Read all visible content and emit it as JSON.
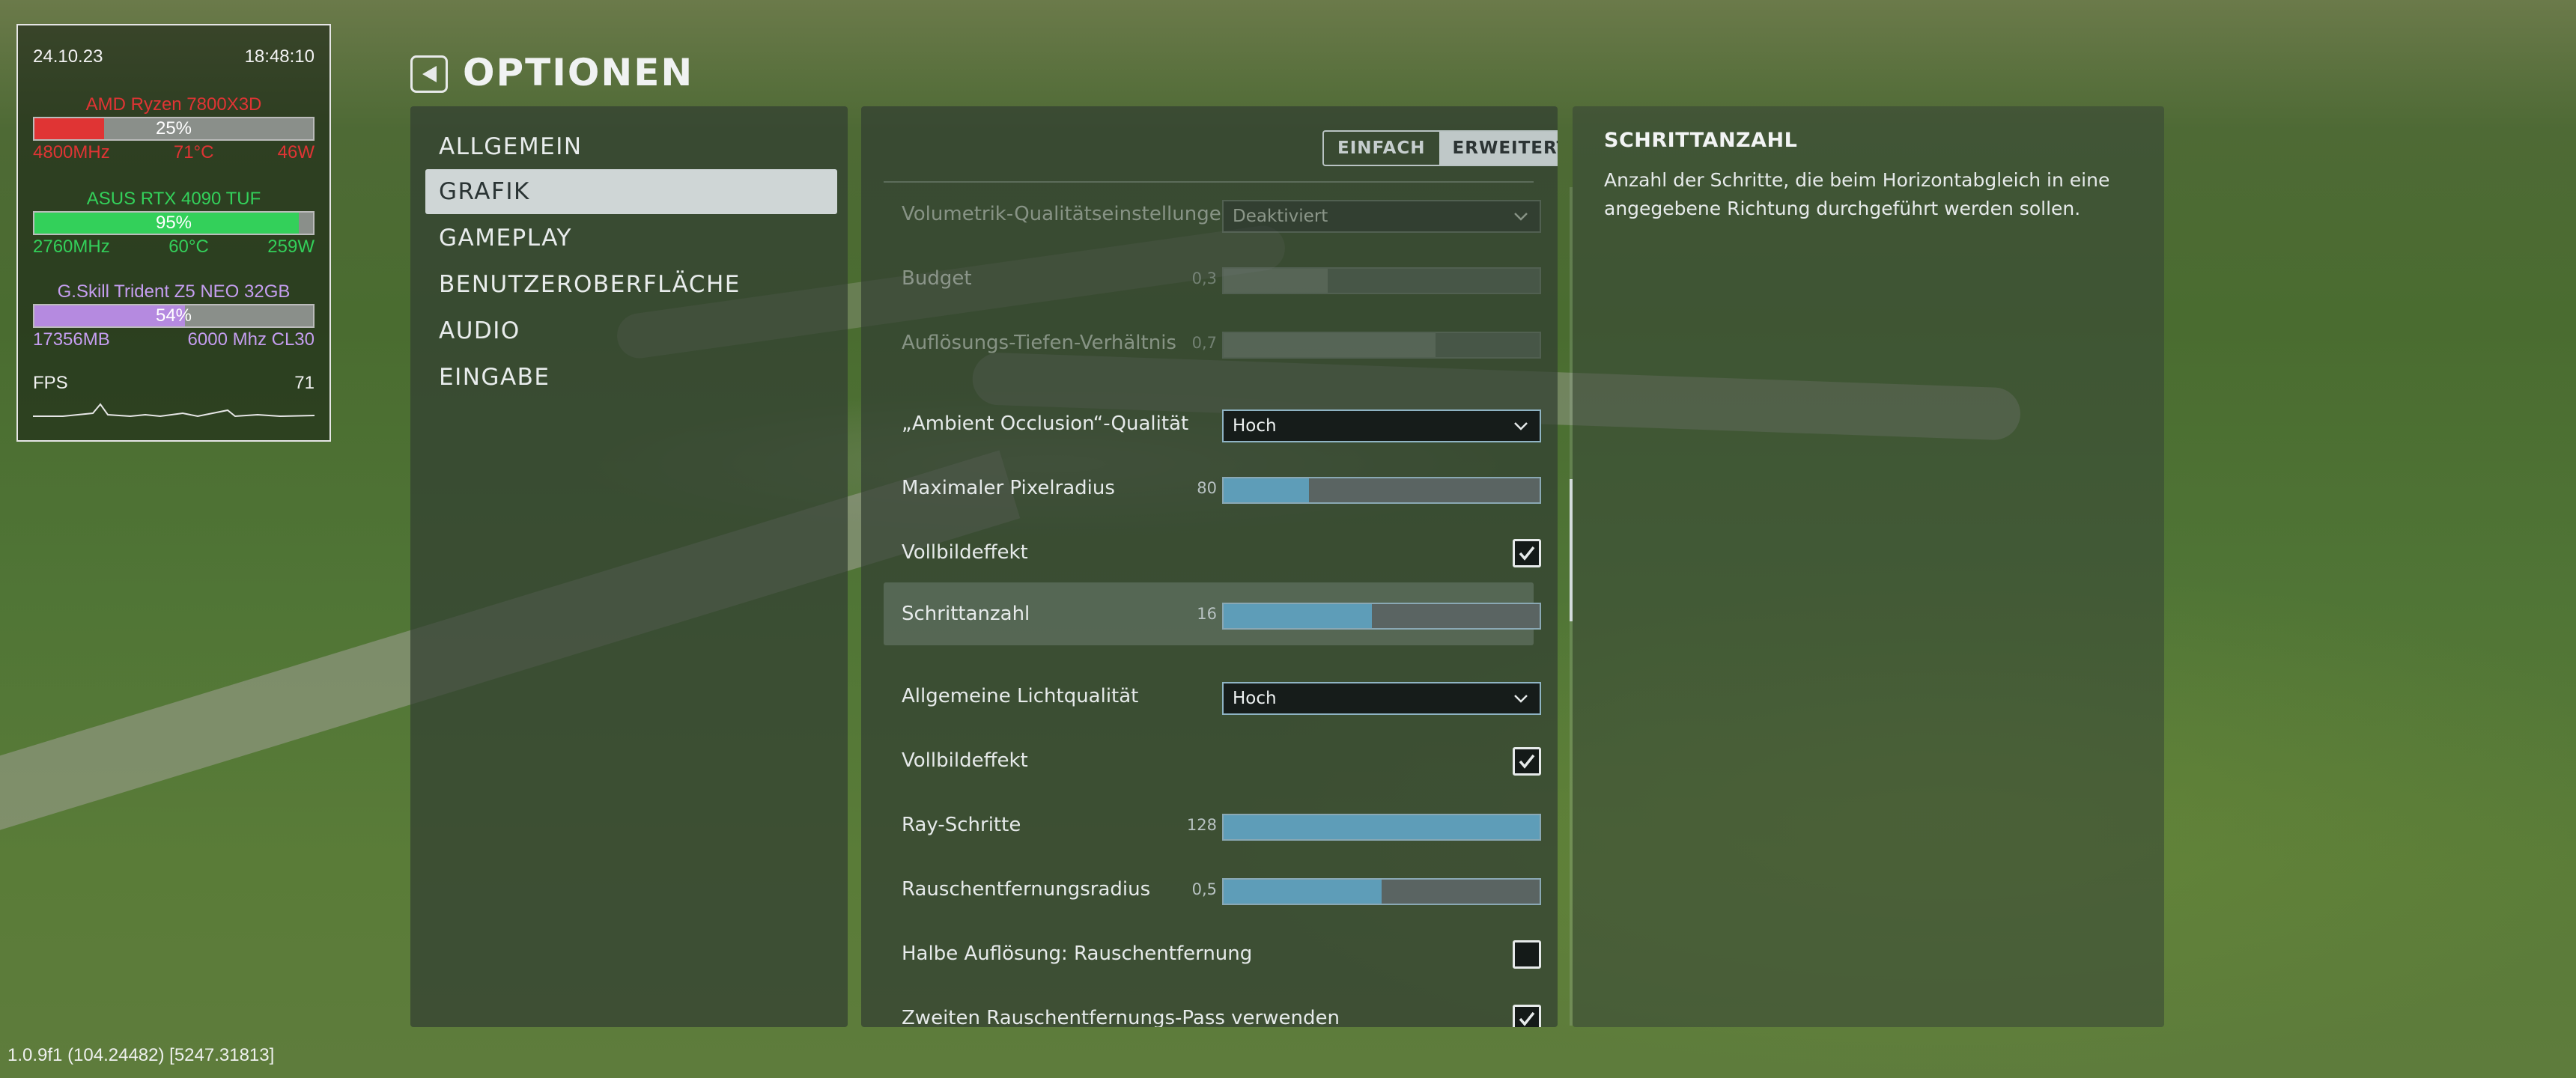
{
  "monitor": {
    "date": "24.10.23",
    "time": "18:48:10",
    "cpu": {
      "name": "AMD Ryzen 7800X3D",
      "load": "25%",
      "load_fraction": 0.25,
      "clock": "4800MHz",
      "temp": "71°C",
      "power": "46W",
      "color": "#e03434"
    },
    "gpu": {
      "name": "ASUS RTX 4090 TUF",
      "load": "95%",
      "load_fraction": 0.95,
      "clock": "2760MHz",
      "temp": "60°C",
      "power": "259W",
      "color": "#33d05a"
    },
    "ram": {
      "name": "G.Skill Trident Z5 NEO 32GB",
      "load": "54%",
      "load_fraction": 0.54,
      "used": "17356MB",
      "speed": "6000 Mhz CL30",
      "color": "#b58ae0"
    },
    "fps": {
      "label": "FPS",
      "value": "71"
    }
  },
  "header": {
    "title": "OPTIONEN",
    "back_icon": "back-arrow-icon"
  },
  "nav": {
    "items": [
      {
        "label": "ALLGEMEIN",
        "active": false
      },
      {
        "label": "GRAFIK",
        "active": true
      },
      {
        "label": "GAMEPLAY",
        "active": false
      },
      {
        "label": "BENUTZEROBERFLÄCHE",
        "active": false
      },
      {
        "label": "AUDIO",
        "active": false
      },
      {
        "label": "EINGABE",
        "active": false
      }
    ]
  },
  "mode": {
    "simple": "EINFACH",
    "advanced": "ERWEITERT",
    "selected": "ERWEITERT"
  },
  "settings": [
    {
      "label": "Volumetrik-Qualitätseinstellungen",
      "type": "dropdown",
      "value": "Deaktiviert",
      "disabled": true
    },
    {
      "label": "Budget",
      "type": "slider",
      "value": "0,3",
      "fill": 0.33,
      "disabled": true
    },
    {
      "label": "Auflösungs-Tiefen-Verhältnis",
      "type": "slider",
      "value": "0,7",
      "fill": 0.67,
      "disabled": true
    },
    {
      "label": "„Ambient Occlusion“-Qualität",
      "type": "dropdown",
      "value": "Hoch",
      "disabled": false
    },
    {
      "label": "Maximaler Pixelradius",
      "type": "slider",
      "value": "80",
      "fill": 0.27,
      "disabled": false
    },
    {
      "label": "Vollbildeffekt",
      "type": "checkbox",
      "checked": true
    },
    {
      "label": "Schrittanzahl",
      "type": "slider",
      "value": "16",
      "fill": 0.47,
      "highlight": true
    },
    {
      "label": "Allgemeine Lichtqualität",
      "type": "dropdown",
      "value": "Hoch",
      "disabled": false
    },
    {
      "label": "Vollbildeffekt",
      "type": "checkbox",
      "checked": true
    },
    {
      "label": "Ray-Schritte",
      "type": "slider",
      "value": "128",
      "fill": 1.0
    },
    {
      "label": "Rauschentfernungsradius",
      "type": "slider",
      "value": "0,5",
      "fill": 0.5
    },
    {
      "label": "Halbe Auflösung: Rauschentfernung",
      "type": "checkbox",
      "checked": false
    },
    {
      "label": "Zweiten Rauschentfernungs-Pass verwenden",
      "type": "checkbox",
      "checked": true
    }
  ],
  "description": {
    "title": "SCHRITTANZAHL",
    "text": "Anzahl der Schritte, die beim Horizontabgleich in eine angegebene Richtung durchgeführt werden sollen."
  },
  "version": "1.0.9f1 (104.24482) [5247.31813]",
  "colors": {
    "slider_fill": "#5e9db8",
    "active_nav": "#cfd6d6"
  }
}
